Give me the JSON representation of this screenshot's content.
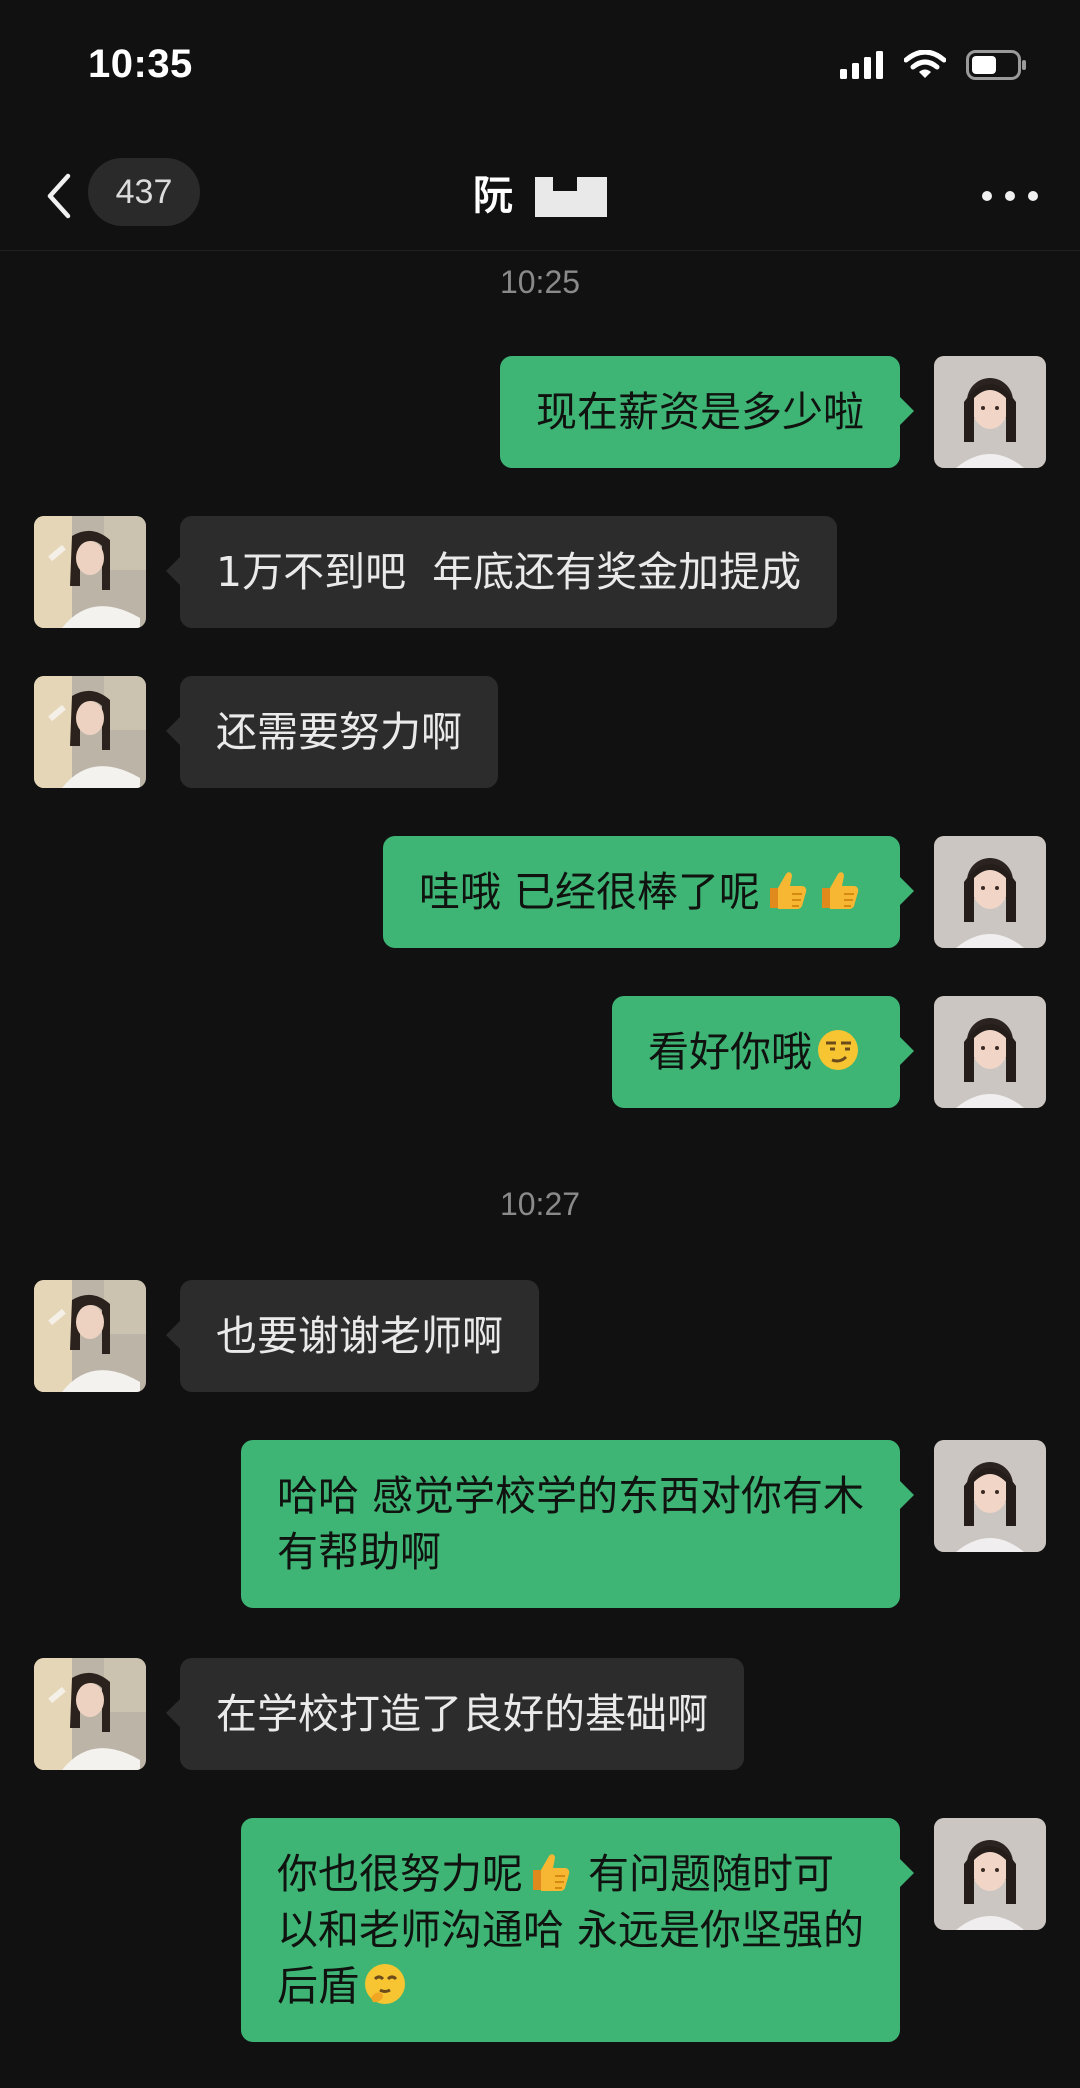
{
  "status_bar": {
    "time": "10:35",
    "icons": [
      "signal-icon",
      "wifi-icon",
      "battery-icon"
    ]
  },
  "header": {
    "unread_count": "437",
    "title": "阮",
    "icons": [
      "back-icon",
      "more-icon"
    ]
  },
  "timestamps": [
    "10:25",
    "10:27"
  ],
  "messages": [
    {
      "side": "out",
      "lines": [
        "现在薪资是多少啦"
      ]
    },
    {
      "side": "in",
      "lines": [
        "1万不到吧  年底还有奖金加提成"
      ]
    },
    {
      "side": "in",
      "lines": [
        "还需要努力啊"
      ]
    },
    {
      "side": "out",
      "lines": [
        "哇哦 已经很棒了呢"
      ],
      "emoji_after": [
        "thumbs-up-icon",
        "thumbs-up-icon"
      ]
    },
    {
      "side": "out",
      "lines": [
        "看好你哦"
      ],
      "emoji_after": [
        "smirk-face-icon"
      ]
    },
    {
      "side": "in",
      "lines": [
        "也要谢谢老师啊"
      ]
    },
    {
      "side": "out",
      "lines": [
        "哈哈 感觉学校学的东西对你有木",
        "有帮助啊"
      ]
    },
    {
      "side": "in",
      "lines": [
        "在学校打造了良好的基础啊"
      ]
    },
    {
      "side": "out",
      "lines": [
        "你也很努力呢",
        " 有问题随时可",
        "以和老师沟通哈 永远是你坚强的",
        "后盾"
      ],
      "emojis": [
        "thumbs-up-icon",
        "shy-face-icon"
      ]
    }
  ],
  "colors": {
    "background": "#111111",
    "outgoing_bubble": "#3eb575",
    "incoming_bubble": "#2c2c2c",
    "timestamp": "#8a8a8a"
  }
}
